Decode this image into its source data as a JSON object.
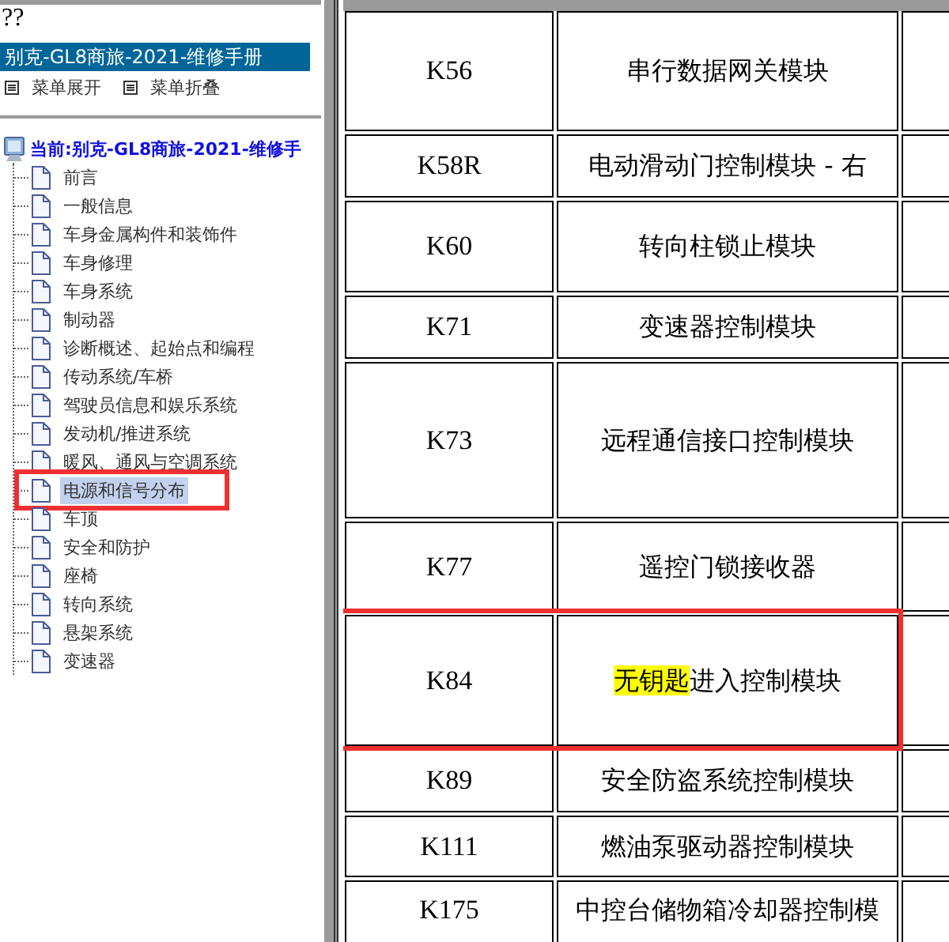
{
  "top_text": "??",
  "manual_title": "别克-GL8商旅-2021-维修手册",
  "menu": [
    {
      "label": "菜单展开"
    },
    {
      "label": "菜单折叠"
    }
  ],
  "tree": {
    "label": "当前:别克-GL8商旅-2021-维修手",
    "children": [
      {
        "label": "前言",
        "selected": false,
        "annotated": false
      },
      {
        "label": "一般信息",
        "selected": false,
        "annotated": false
      },
      {
        "label": "车身金属构件和装饰件",
        "selected": false,
        "annotated": false
      },
      {
        "label": "车身修理",
        "selected": false,
        "annotated": false
      },
      {
        "label": "车身系统",
        "selected": false,
        "annotated": false
      },
      {
        "label": "制动器",
        "selected": false,
        "annotated": false
      },
      {
        "label": "诊断概述、起始点和编程",
        "selected": false,
        "annotated": false
      },
      {
        "label": "传动系统/车桥",
        "selected": false,
        "annotated": false
      },
      {
        "label": "驾驶员信息和娱乐系统",
        "selected": false,
        "annotated": false
      },
      {
        "label": "发动机/推进系统",
        "selected": false,
        "annotated": false
      },
      {
        "label": "暖风、通风与空调系统",
        "selected": false,
        "annotated": false
      },
      {
        "label": "电源和信号分布",
        "selected": true,
        "annotated": true
      },
      {
        "label": "车顶",
        "selected": false,
        "annotated": false
      },
      {
        "label": "安全和防护",
        "selected": false,
        "annotated": false
      },
      {
        "label": "座椅",
        "selected": false,
        "annotated": false
      },
      {
        "label": "转向系统",
        "selected": false,
        "annotated": false
      },
      {
        "label": "悬架系统",
        "selected": false,
        "annotated": false
      },
      {
        "label": "变速器",
        "selected": false,
        "annotated": false
      }
    ]
  },
  "table": {
    "rows": [
      {
        "code": "K56",
        "name": "串行数据网关模块",
        "annotated": false
      },
      {
        "code": "K58R",
        "name": "电动滑动门控制模块 - 右",
        "annotated": false
      },
      {
        "code": "K60",
        "name": "转向柱锁止模块",
        "annotated": false
      },
      {
        "code": "K71",
        "name": "变速器控制模块",
        "annotated": false
      },
      {
        "code": "K73",
        "name": "远程通信接口控制模块",
        "annotated": false
      },
      {
        "code": "K77",
        "name": "遥控门锁接收器",
        "annotated": false
      },
      {
        "code": "K84",
        "name_highlight": "无钥匙",
        "name": "进入控制模块",
        "annotated": true
      },
      {
        "code": "K89",
        "name": "安全防盗系统控制模块",
        "annotated": false
      },
      {
        "code": "K111",
        "name": "燃油泵驱动器控制模块",
        "annotated": false
      },
      {
        "code": "K175",
        "name": "中控台储物箱冷却器控制模",
        "annotated": false
      }
    ]
  }
}
